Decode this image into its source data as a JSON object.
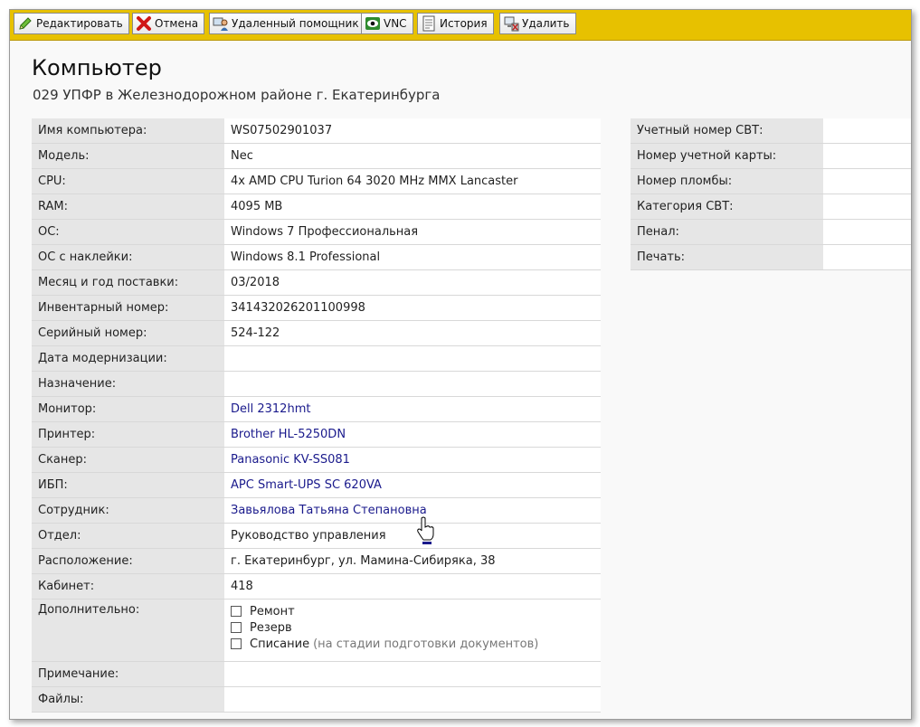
{
  "toolbar": {
    "buttons": [
      {
        "label": "Редактировать",
        "icon": "pencil-icon"
      },
      {
        "label": "Отмена",
        "icon": "red-x-icon"
      },
      {
        "label": "Удаленный помощник",
        "icon": "remote-assistant-icon"
      },
      {
        "label": "VNC",
        "icon": "vnc-eye-icon"
      },
      {
        "label": "История",
        "icon": "history-document-icon"
      },
      {
        "label": "Удалить",
        "icon": "delete-computer-icon"
      }
    ]
  },
  "page": {
    "title": "Компьютер",
    "subtitle": "029 УПФР в Железнодорожном районе г. Екатеринбурга"
  },
  "left_rows": [
    {
      "label": "Имя компьютера:",
      "value": "WS07502901037"
    },
    {
      "label": "Модель:",
      "value": "Nec"
    },
    {
      "label": "CPU:",
      "value": "4x AMD CPU Turion 64 3020 MHz MMX Lancaster"
    },
    {
      "label": "RAM:",
      "value": "4095 MB"
    },
    {
      "label": "ОС:",
      "value": "Windows 7 Профессиональная"
    },
    {
      "label": "ОС с наклейки:",
      "value": "Windows 8.1 Professional"
    },
    {
      "label": "Месяц и год поставки:",
      "value": "03/2018"
    },
    {
      "label": "Инвентарный номер:",
      "value": "341432026201100998"
    },
    {
      "label": "Серийный номер:",
      "value": "524-122"
    },
    {
      "label": "Дата модернизации:",
      "value": ""
    },
    {
      "label": "Назначение:",
      "value": ""
    },
    {
      "label": "Монитор:",
      "value": "Dell 2312hmt"
    },
    {
      "label": "Принтер:",
      "value": "Brother HL-5250DN"
    },
    {
      "label": "Сканер:",
      "value": "Panasonic KV-SS081"
    },
    {
      "label": "ИБП:",
      "value": "APC Smart-UPS SC 620VA"
    },
    {
      "label": "Сотрудник:",
      "value": "Завьялова Татьяна Степановна"
    },
    {
      "label": "Отдел:",
      "value": "Руководство управления"
    },
    {
      "label": "Расположение:",
      "value": "г. Екатеринбург, ул. Мамина-Сибиряка, 38"
    },
    {
      "label": "Кабинет:",
      "value": "418"
    }
  ],
  "extra": {
    "label": "Дополнительно:",
    "checkboxes": [
      {
        "label": "Ремонт",
        "checked": false
      },
      {
        "label": "Резерв",
        "checked": false
      },
      {
        "label": "Списание",
        "checked": false,
        "hint": "(на стадии подготовки документов)"
      }
    ]
  },
  "bottom_rows": [
    {
      "label": "Примечание:",
      "value": ""
    },
    {
      "label": "Файлы:",
      "value": ""
    }
  ],
  "right_rows": [
    {
      "label": "Учетный номер СВТ:",
      "value": ""
    },
    {
      "label": "Номер учетной карты:",
      "value": ""
    },
    {
      "label": "Номер пломбы:",
      "value": ""
    },
    {
      "label": "Категория СВТ:",
      "value": ""
    },
    {
      "label": "Пенал:",
      "value": ""
    },
    {
      "label": "Печать:",
      "value": ""
    }
  ],
  "colors": {
    "toolbar": "#e7c100",
    "label_bg": "#e6e6e6",
    "link": "#1a1a8c"
  }
}
